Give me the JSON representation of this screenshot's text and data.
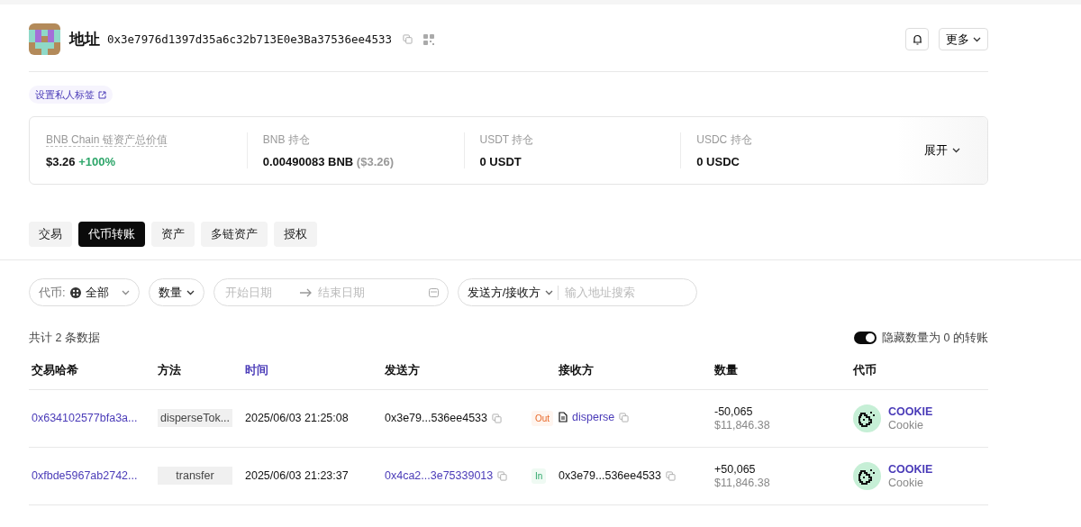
{
  "header": {
    "title": "地址",
    "address": "0x3e7976d1397d35a6c32b713E0e3Ba37536ee4533",
    "more": "更多"
  },
  "private_tag": "设置私人标签",
  "summary": [
    {
      "label": "BNB Chain 链资产总价值",
      "value": "$3.26",
      "change": "+100%",
      "dotted": true
    },
    {
      "label": "BNB 持仓",
      "value": "0.00490083 BNB",
      "sub": "($3.26)",
      "dotted": false
    },
    {
      "label": "USDT 持仓",
      "value": "0 USDT",
      "dotted": false
    },
    {
      "label": "USDC 持仓",
      "value": "0 USDC",
      "dotted": false
    }
  ],
  "expand": "展开",
  "tabs": [
    {
      "label": "交易",
      "selected": false
    },
    {
      "label": "代币转账",
      "selected": true
    },
    {
      "label": "资产",
      "selected": false
    },
    {
      "label": "多链资产",
      "selected": false
    },
    {
      "label": "授权",
      "selected": false
    }
  ],
  "filters": {
    "token_label": "代币:",
    "token_value": "全部",
    "amount": "数量",
    "start_placeholder": "开始日期",
    "end_placeholder": "结束日期",
    "party": "发送方/接收方",
    "search_placeholder": "输入地址搜索"
  },
  "count": "共计 2 条数据",
  "hide_zero": {
    "label": "隐藏数量为 0 的转账",
    "on": true
  },
  "columns": [
    {
      "label": "交易哈希",
      "sortable": false
    },
    {
      "label": "方法",
      "sortable": false
    },
    {
      "label": "时间",
      "sortable": true
    },
    {
      "label": "发送方",
      "sortable": false
    },
    {
      "label": "接收方",
      "sortable": false
    },
    {
      "label": "数量",
      "sortable": false
    },
    {
      "label": "代币",
      "sortable": false
    }
  ],
  "rows": [
    {
      "hash": "0x634102577bfa3a...",
      "method": "disperseTok...",
      "time": "2025/06/03 21:25:08",
      "sender": "0x3e79...536ee4533",
      "sender_link": false,
      "direction": {
        "kind": "out",
        "label": "Out"
      },
      "receiver": "disperse",
      "receiver_link": true,
      "receiver_contract": true,
      "amount": "-50,065",
      "usd": "$11,846.38",
      "token_symbol": "COOKIE",
      "token_name": "Cookie"
    },
    {
      "hash": "0xfbde5967ab2742...",
      "method": "transfer",
      "time": "2025/06/03 21:23:37",
      "sender": "0x4ca2...3e75339013",
      "sender_link": true,
      "direction": {
        "kind": "in",
        "label": "In"
      },
      "receiver": "0x3e79...536ee4533",
      "receiver_link": false,
      "receiver_contract": false,
      "amount": "+50,065",
      "usd": "$11,846.38",
      "token_symbol": "COOKIE",
      "token_name": "Cookie"
    }
  ]
}
